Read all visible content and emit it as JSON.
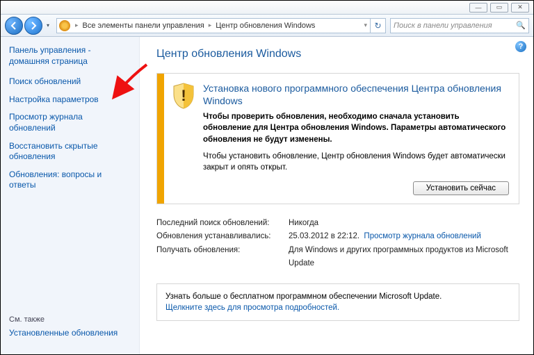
{
  "window": {
    "min_glyph": "—",
    "max_glyph": "▭",
    "close_glyph": "✕"
  },
  "breadcrumb": {
    "seg1": "Все элементы панели управления",
    "seg2": "Центр обновления Windows"
  },
  "search": {
    "placeholder": "Поиск в панели управления"
  },
  "sidebar": {
    "home": "Панель управления - домашняя страница",
    "links": [
      "Поиск обновлений",
      "Настройка параметров",
      "Просмотр журнала обновлений",
      "Восстановить скрытые обновления",
      "Обновления: вопросы и ответы"
    ],
    "seealso_label": "См. также",
    "seealso_link": "Установленные обновления"
  },
  "page": {
    "title": "Центр обновления Windows"
  },
  "alert": {
    "title": "Установка нового программного обеспечения Центра обновления Windows",
    "bold": "Чтобы проверить обновления, необходимо сначала установить обновление для Центра обновления Windows. Параметры автоматического обновления не будут изменены.",
    "plain": "Чтобы установить обновление, Центр обновления Windows будет автоматически закрыт и опять открыт.",
    "button": "Установить сейчас"
  },
  "info": {
    "last_check_label": "Последний поиск обновлений:",
    "last_check_value": "Никогда",
    "installed_label": "Обновления устанавливались:",
    "installed_value": "25.03.2012 в 22:12.",
    "installed_link": "Просмотр журнала обновлений",
    "receive_label": "Получать обновления:",
    "receive_value": "Для Windows и других программных продуктов из Microsoft Update"
  },
  "msupdate": {
    "text": "Узнать больше о бесплатном программном обеспечении Microsoft Update.",
    "link": "Щелкните здесь для просмотра подробностей."
  }
}
